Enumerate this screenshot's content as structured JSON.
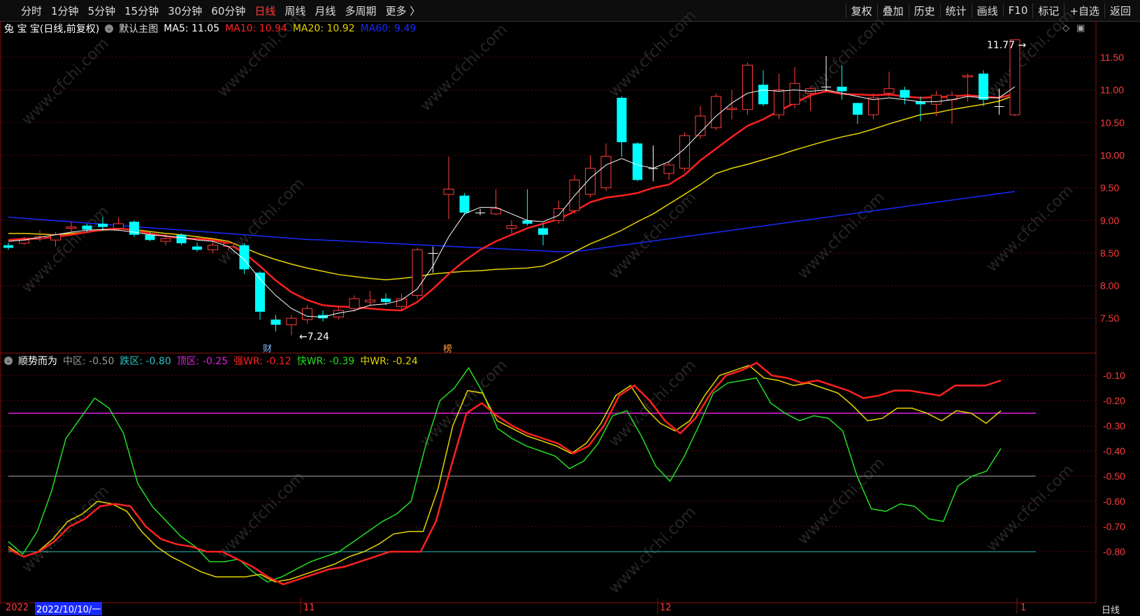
{
  "toolbar": {
    "periods": [
      "分时",
      "1分钟",
      "5分钟",
      "15分钟",
      "30分钟",
      "60分钟",
      "日线",
      "周线",
      "月线",
      "多周期",
      "更多 〉"
    ],
    "active_period": "日线",
    "right_buttons": [
      "复权",
      "叠加",
      "历史",
      "统计",
      "画线",
      "F10",
      "标记",
      "+自选",
      "返回"
    ]
  },
  "main_chart": {
    "stock_name": "兔 宝 宝(日线,前复权)",
    "template_label": "默认主图",
    "ma5_label": "MA5: 11.05",
    "ma10_label": "MA10: 10.94",
    "ma20_label": "MA20: 10.92",
    "ma60_label": "MA60: 9.49",
    "high_marker": "11.77",
    "low_marker": "7.24",
    "event_tag_1": "财",
    "event_tag_2": "榜",
    "colors": {
      "up": "#ff3b3b",
      "down": "#00ffff",
      "ma5": "#ffffff",
      "ma10": "#ff2020",
      "ma20": "#e6d400",
      "ma60": "#1a2aff"
    }
  },
  "indicator": {
    "name": "顺势而为",
    "mid_label": "中区: -0.50",
    "fall_label": "跌区: -0.80",
    "top_label": "顶区: -0.25",
    "strong_label": "强WR: -0.12",
    "fast_label": "快WR: -0.39",
    "med_label": "中WR: -0.24",
    "colors": {
      "strong": "#ff2020",
      "fast": "#22dd22",
      "med": "#e6d400",
      "top": "#e020e0",
      "mid": "#aaaaaa",
      "fall": "#30c0c0"
    }
  },
  "price_axis": [
    "11.50",
    "11.00",
    "10.50",
    "10.00",
    "9.50",
    "9.00",
    "8.50",
    "8.00",
    "7.50"
  ],
  "indicator_axis": [
    "-0.10",
    "-0.20",
    "-0.30",
    "-0.40",
    "-0.50",
    "-0.60",
    "-0.70",
    "-0.80"
  ],
  "time_axis": {
    "year_label": "2022",
    "cursor_date": "2022/10/10/一",
    "month_11": "11",
    "month_12": "12",
    "month_1": "1",
    "period_box": "日线"
  },
  "watermark": "www.cfchi.com"
}
